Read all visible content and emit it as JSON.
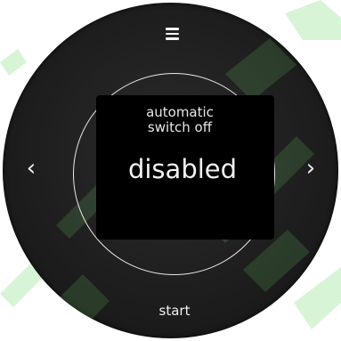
{
  "menu": {
    "icon": "hamburger-menu-icon"
  },
  "navigation": {
    "prev_icon": "chevron-left-icon",
    "prev_glyph": "‹",
    "next_icon": "chevron-right-icon",
    "next_glyph": "›"
  },
  "display": {
    "title_line1": "automatic",
    "title_line2": "switch off",
    "value": "disabled"
  },
  "start_button": {
    "label": "start"
  },
  "colors": {
    "device_body": "#1e1e1e",
    "screen": "#000000",
    "text": "#f2f2f2",
    "watermark": "#8ee08a"
  }
}
